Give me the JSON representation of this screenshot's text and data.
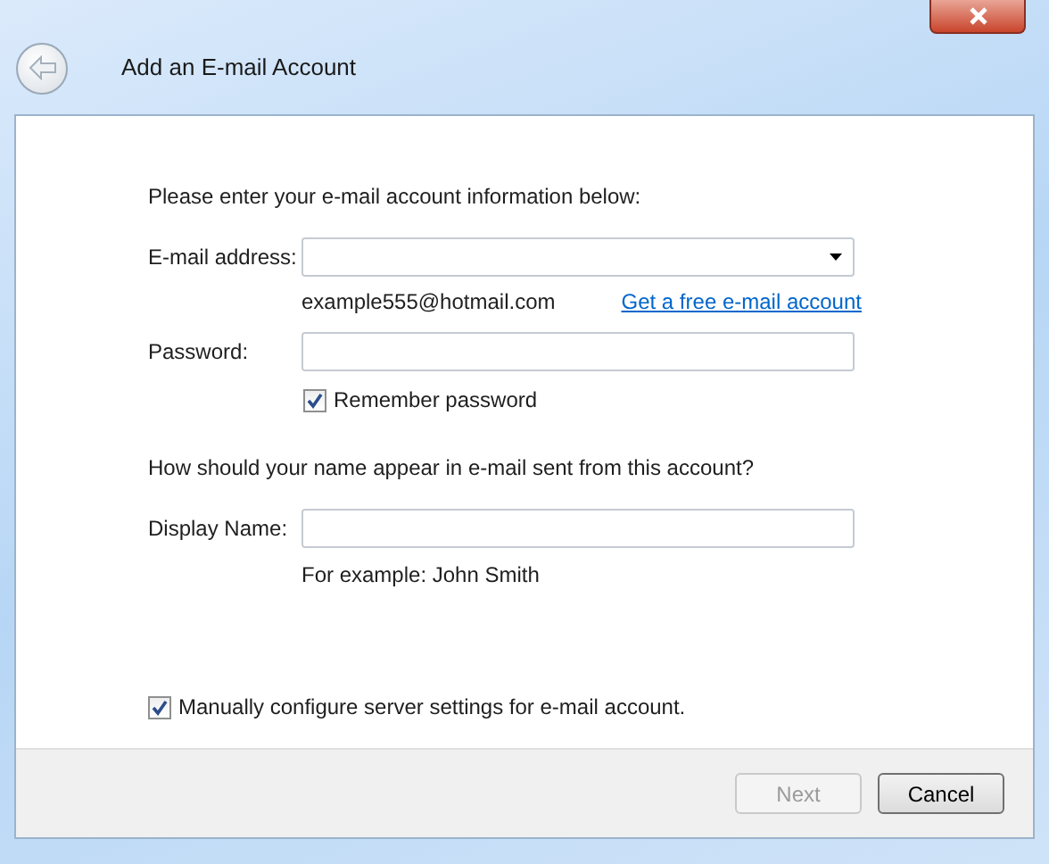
{
  "window": {
    "title": "Add an E-mail Account"
  },
  "intro": "Please enter your e-mail account information below:",
  "email": {
    "label": "E-mail address:",
    "hint": "example555@hotmail.com",
    "link": "Get a free e-mail account"
  },
  "password": {
    "label": "Password:"
  },
  "remember": {
    "label": "Remember password",
    "checked": true
  },
  "question": "How should your name appear in e-mail sent from this account?",
  "display_name": {
    "label": "Display Name:",
    "hint": "For example: John Smith"
  },
  "manual": {
    "label": "Manually configure server settings for e-mail account.",
    "checked": true
  },
  "buttons": [
    {
      "label": "Next",
      "disabled": true
    },
    {
      "label": "Cancel",
      "disabled": false
    }
  ]
}
